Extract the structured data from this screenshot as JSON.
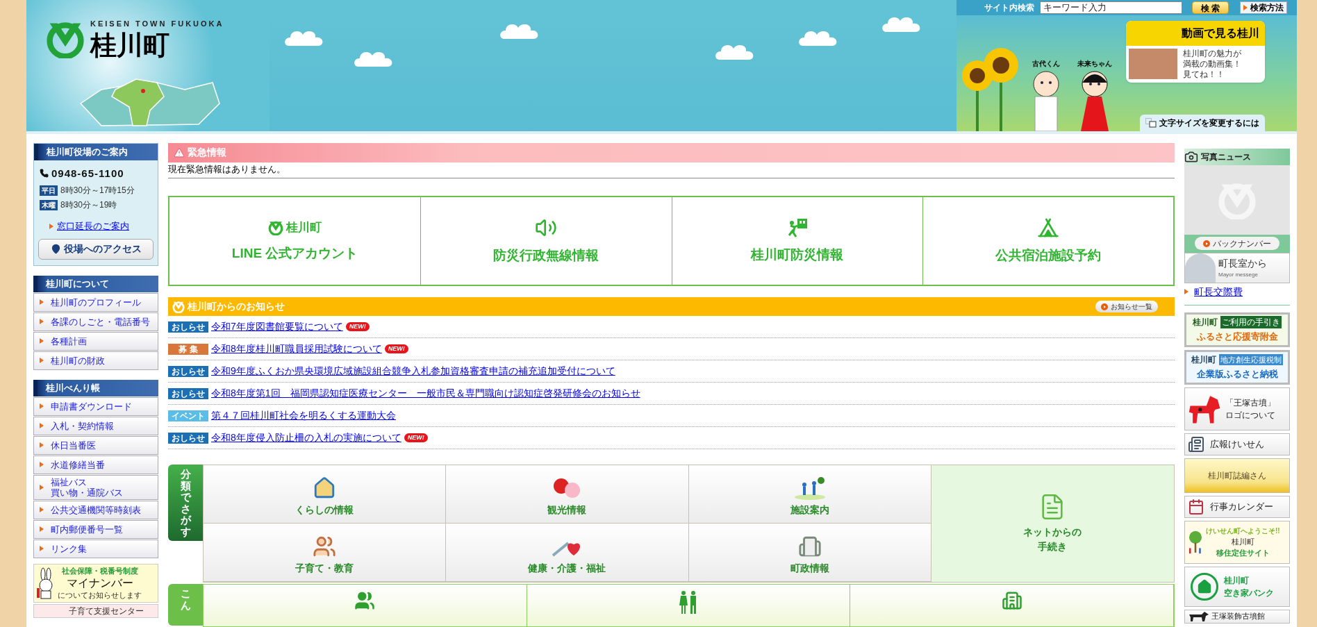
{
  "header": {
    "tagline": "KEISEN TOWN FUKUOKA",
    "town_name": "桂川町",
    "search": {
      "label": "サイト内検索",
      "placeholder": "キーワード入力",
      "button": "検 索",
      "help_link": "検索方法"
    },
    "characters": [
      "古代くん",
      "未来ちゃん"
    ],
    "video_banner": {
      "title": "動画で見る桂川",
      "lines": [
        "桂川町の魅力が",
        "満載の動画集！",
        "見てね！！"
      ]
    },
    "font_size_link": "文字サイズを変更するには"
  },
  "left_sidebar": {
    "office": {
      "title": "桂川町役場のご案内",
      "phone": "0948-65-1100",
      "hours": [
        {
          "day": "平日",
          "time": "8時30分～17時15分"
        },
        {
          "day": "木曜",
          "time": "8時30分～19時"
        }
      ],
      "link": "窓口延長のご案内",
      "access_button": "役場へのアクセス"
    },
    "menus": [
      {
        "title": "桂川町について",
        "items": [
          "桂川町のプロフィール",
          "各課のしごと・電話番号",
          "各種計画",
          "桂川町の財政"
        ]
      },
      {
        "title": "桂川べんり帳",
        "items": [
          "申請書ダウンロード",
          "入札・契約情報",
          "休日当番医",
          "水道修繕当番",
          [
            "福祉バス",
            "買い物・通院バス"
          ],
          "公共交通機関等時刻表",
          "町内郵便番号一覧",
          "リンク集"
        ]
      }
    ],
    "banners": [
      {
        "kind": "mynumber",
        "lines": [
          "社会保障・税番号制度",
          "マイナンバー",
          "についてお知らせします"
        ]
      },
      {
        "kind": "childcare",
        "lines": [
          "子育て支援センター"
        ]
      }
    ]
  },
  "emergency": {
    "title": "緊急情報",
    "message": "現在緊急情報はありません。"
  },
  "quick_links": [
    {
      "kind": "line",
      "logo_text": "桂川町",
      "label": "LINE 公式アカウント"
    },
    {
      "kind": "radio",
      "label": "防災行政無線情報"
    },
    {
      "kind": "evacuation",
      "label": "桂川町防災情報"
    },
    {
      "kind": "tent",
      "label": "公共宿泊施設予約"
    }
  ],
  "notices": {
    "title": "桂川町からのお知らせ",
    "more": "お知らせ一覧",
    "items": [
      {
        "tag": "おしらせ",
        "color": "#1a6fb5",
        "text": "令和7年度図書館要覧について",
        "badge": "NEW!"
      },
      {
        "tag": "募 集",
        "color": "#d9773a",
        "text": "令和8年度桂川町職員採用試験について",
        "badge": "NEW!"
      },
      {
        "tag": "おしらせ",
        "color": "#1a6fb5",
        "text": "令和9年度ふくおか県央環境広域施設組合競争入札参加資格審査申請の補充追加受付について"
      },
      {
        "tag": "おしらせ",
        "color": "#1a6fb5",
        "text": "令和8年度第1回　福岡県認知症医療センター　一般市民＆専門職向け認知症啓発研修会のお知らせ"
      },
      {
        "tag": "イベント",
        "color": "#5bbde6",
        "text": "第４７回桂川町社会を明るくする運動大会"
      },
      {
        "tag": "おしらせ",
        "color": "#1a6fb5",
        "text": "令和8年度侵入防止柵の入札の実施について",
        "badge": "NEW!"
      }
    ]
  },
  "categories": {
    "tab": "分類でさがす",
    "items": [
      {
        "kind": "house",
        "label": "くらしの情報"
      },
      {
        "kind": "fan",
        "label": "観光情報"
      },
      {
        "kind": "park",
        "label": "施設案内"
      },
      {
        "kind": "faces",
        "label": "子育て・教育"
      },
      {
        "kind": "syringe",
        "label": "健康・介護・福祉"
      },
      {
        "kind": "townhall",
        "label": "町政情報"
      }
    ],
    "side": {
      "label": "ネットからの手続き"
    }
  },
  "life_stages": {
    "tab": "こん",
    "items": [
      {
        "kind": "family"
      },
      {
        "kind": "couple"
      },
      {
        "kind": "building"
      }
    ]
  },
  "right_sidebar": {
    "photo_news": {
      "title": "写真ニュース",
      "back_number": "バックナンバー"
    },
    "mayor": {
      "title": "町長室から",
      "subtitle": "Mayor messege"
    },
    "link": "町長交際費",
    "banners": [
      {
        "kind": "furusato",
        "lines": [
          "桂川町",
          "ご利用の手引き",
          "ふるさと応援寄附金"
        ]
      },
      {
        "kind": "corporate",
        "lines": [
          "桂川町",
          "地方創生応援税制",
          "企業版ふるさと納税"
        ]
      },
      {
        "kind": "logo",
        "lines": [
          "「王塚古墳」",
          "ロゴについて"
        ]
      },
      {
        "kind": "pr",
        "lines": [
          "広報けいせん"
        ]
      },
      {
        "kind": "history",
        "lines": [
          "桂川町誌編さん"
        ]
      },
      {
        "kind": "calendar",
        "lines": [
          "行事カレンダー"
        ]
      },
      {
        "kind": "migration",
        "lines": [
          "けいせん町へようこそ!!",
          "桂川町",
          "移住定住サイト"
        ]
      },
      {
        "kind": "vacant",
        "lines": [
          "桂川町",
          "空き家バンク"
        ]
      },
      {
        "kind": "museum",
        "lines": [
          "王塚装飾古墳館"
        ]
      }
    ]
  }
}
